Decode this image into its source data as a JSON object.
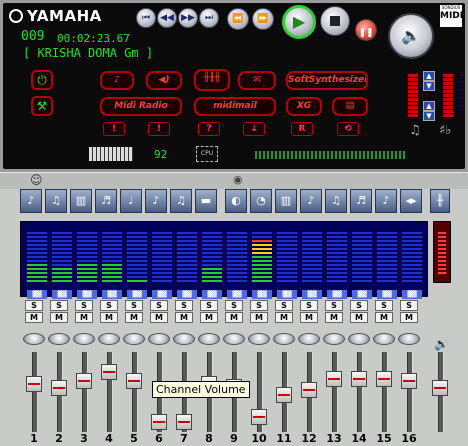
{
  "app": {
    "brand": "YAMAHA",
    "badge_top": "SONDIUS",
    "badge_bottom": "MIDI"
  },
  "transport": {
    "buttons": [
      "skip-back",
      "rewind-small",
      "forward-small",
      "skip-forward",
      "fast-rewind",
      "fast-forward"
    ],
    "play_icon": "play-icon",
    "stop_icon": "stop-icon",
    "pause_icon": "pause-icon"
  },
  "display": {
    "track_number": "009",
    "time": "00:02:23.67",
    "title": "[ KRISHA DOMA Gm ]",
    "tempo": "92",
    "cpu_label": "CPU"
  },
  "func_buttons": {
    "softsynth": "SoftSynthesizer",
    "midiradio": "Midi Radio",
    "midimail": "midimail",
    "xg": "XG"
  },
  "small_buttons": [
    "!",
    "?",
    "↓",
    "R",
    "⟲"
  ],
  "mixer": {
    "tooltip": "Channel Volume",
    "channels": [
      {
        "n": "1",
        "level": 0.62,
        "meter": 0.35
      },
      {
        "n": "2",
        "level": 0.55,
        "meter": 0.3
      },
      {
        "n": "3",
        "level": 0.66,
        "meter": 0.42
      },
      {
        "n": "4",
        "level": 0.8,
        "meter": 0.4
      },
      {
        "n": "5",
        "level": 0.66,
        "meter": 0.05
      },
      {
        "n": "6",
        "level": 0.0,
        "meter": 0.0
      },
      {
        "n": "7",
        "level": 0.0,
        "meter": 0.0
      },
      {
        "n": "8",
        "level": 0.62,
        "meter": 0.32
      },
      {
        "n": "9",
        "level": 0.56,
        "meter": 0.0
      },
      {
        "n": "10",
        "level": 0.08,
        "meter": 0.82
      },
      {
        "n": "11",
        "level": 0.43,
        "meter": 0.0
      },
      {
        "n": "12",
        "level": 0.52,
        "meter": 0.0
      },
      {
        "n": "13",
        "level": 0.7,
        "meter": 0.0
      },
      {
        "n": "14",
        "level": 0.7,
        "meter": 0.0
      },
      {
        "n": "15",
        "level": 0.7,
        "meter": 0.0
      },
      {
        "n": "16",
        "level": 0.66,
        "meter": 0.0
      }
    ],
    "master_level": 0.55,
    "solo_label": "S",
    "mute_label": "M"
  },
  "colors": {
    "lcd_green": "#22e022",
    "led_red": "#d00000",
    "accent_blue": "#00005a"
  }
}
